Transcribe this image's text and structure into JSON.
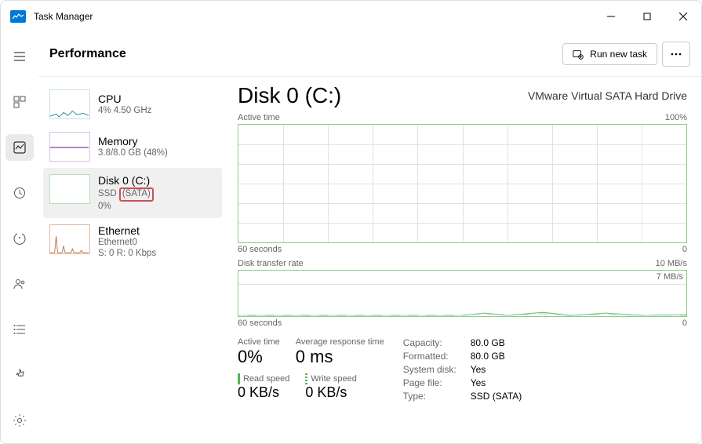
{
  "app": {
    "title": "Task Manager"
  },
  "header": {
    "title": "Performance",
    "run_task_label": "Run new task"
  },
  "sidebar": {
    "items": [
      {
        "name": "CPU",
        "subtitle": "4%  4.50 GHz"
      },
      {
        "name": "Memory",
        "subtitle": "3.8/8.0 GB (48%)"
      },
      {
        "name": "Disk 0 (C:)",
        "line2_prefix": "SSD ",
        "line2_highlight": "(SATA)",
        "line3": "0%"
      },
      {
        "name": "Ethernet",
        "line2": "Ethernet0",
        "line3": "S: 0 R: 0 Kbps"
      }
    ]
  },
  "detail": {
    "title": "Disk 0 (C:)",
    "subtitle": "VMware Virtual SATA Hard Drive",
    "chart1": {
      "label": "Active time",
      "ymax": "100%",
      "xleft": "60 seconds",
      "xright": "0"
    },
    "chart2": {
      "label": "Disk transfer rate",
      "ymax": "10 MB/s",
      "innerlabel": "7 MB/s",
      "xleft": "60 seconds",
      "xright": "0"
    },
    "stats": {
      "active_time": {
        "label": "Active time",
        "value": "0%"
      },
      "avg_response": {
        "label": "Average response time",
        "value": "0 ms"
      },
      "read_speed": {
        "label": "Read speed",
        "value": "0 KB/s"
      },
      "write_speed": {
        "label": "Write speed",
        "value": "0 KB/s"
      },
      "props": {
        "capacity": {
          "k": "Capacity:",
          "v": "80.0 GB"
        },
        "formatted": {
          "k": "Formatted:",
          "v": "80.0 GB"
        },
        "system_disk": {
          "k": "System disk:",
          "v": "Yes"
        },
        "page_file": {
          "k": "Page file:",
          "v": "Yes"
        },
        "type": {
          "k": "Type:",
          "v": "SSD (SATA)"
        }
      }
    }
  },
  "chart_data": [
    {
      "type": "line",
      "title": "Active time",
      "xlabel": "60 seconds → 0",
      "ylabel": "%",
      "ylim": [
        0,
        100
      ],
      "x": [
        60,
        55,
        50,
        45,
        40,
        35,
        30,
        25,
        20,
        15,
        10,
        5,
        0
      ],
      "values": [
        0,
        0,
        0,
        0,
        0,
        0,
        0,
        0,
        0,
        0,
        0,
        0,
        0
      ]
    },
    {
      "type": "line",
      "title": "Disk transfer rate",
      "xlabel": "60 seconds → 0",
      "ylabel": "MB/s",
      "ylim": [
        0,
        10
      ],
      "annotations": [
        "7 MB/s"
      ],
      "series": [
        {
          "name": "Read",
          "x": [
            60,
            55,
            50,
            45,
            40,
            35,
            30,
            25,
            20,
            15,
            10,
            5,
            0
          ],
          "values": [
            0,
            0,
            0,
            0,
            0,
            0,
            0,
            0.3,
            0,
            0.5,
            0,
            0.4,
            0
          ]
        },
        {
          "name": "Write",
          "x": [
            60,
            55,
            50,
            45,
            40,
            35,
            30,
            25,
            20,
            15,
            10,
            5,
            0
          ],
          "values": [
            0,
            0,
            0,
            0,
            0,
            0,
            0,
            0.2,
            0,
            0.3,
            0,
            0.2,
            0
          ]
        }
      ]
    }
  ]
}
